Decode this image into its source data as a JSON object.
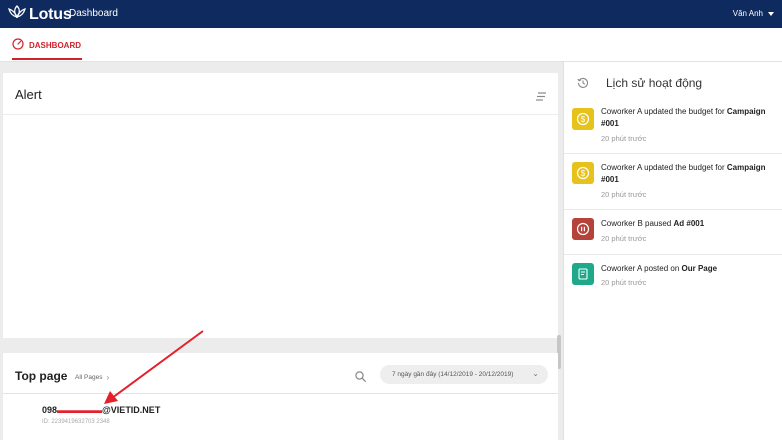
{
  "header": {
    "logo_text": "Lotus",
    "breadcrumb": "Dashboard",
    "user_name": "Văn Anh"
  },
  "tabs": [
    {
      "label": "DASHBOARD",
      "icon": "gauge-icon",
      "active": true
    }
  ],
  "alert": {
    "title": "Alert",
    "menu_icon": "list-icon"
  },
  "top_page": {
    "title": "Top page",
    "all_pages_link": "All Pages",
    "date_range": "7 ngày gần đây (14/12/2019 - 20/12/2019)",
    "rows": [
      {
        "email_prefix": "098",
        "email_redacted": "▬▬▬▬▬",
        "email_suffix": "@VIETID.NET",
        "id_text": "ID: 2239419632703 2348"
      }
    ]
  },
  "activity": {
    "title": "Lịch sử hoạt động",
    "items": [
      {
        "icon": "coin-icon",
        "color": "#e8c21c",
        "actor": "Coworker A updated the budget for ",
        "target": "Campaign #001",
        "time": "20 phút trước"
      },
      {
        "icon": "coin-icon",
        "color": "#e8c21c",
        "actor": "Coworker A updated the budget for ",
        "target": "Campaign #001",
        "time": "20 phút trước"
      },
      {
        "icon": "pause-icon",
        "color": "#b5433a",
        "actor": "Coworker B paused ",
        "target": "Ad #001",
        "time": "20 phút trước"
      },
      {
        "icon": "post-icon",
        "color": "#1fa88a",
        "actor": "Coworker A posted on ",
        "target": "Our Page",
        "time": "20 phút trước"
      }
    ]
  },
  "colors": {
    "topbar": "#0f2a5e",
    "accent": "#d0222a",
    "arrow": "#e4202a"
  }
}
